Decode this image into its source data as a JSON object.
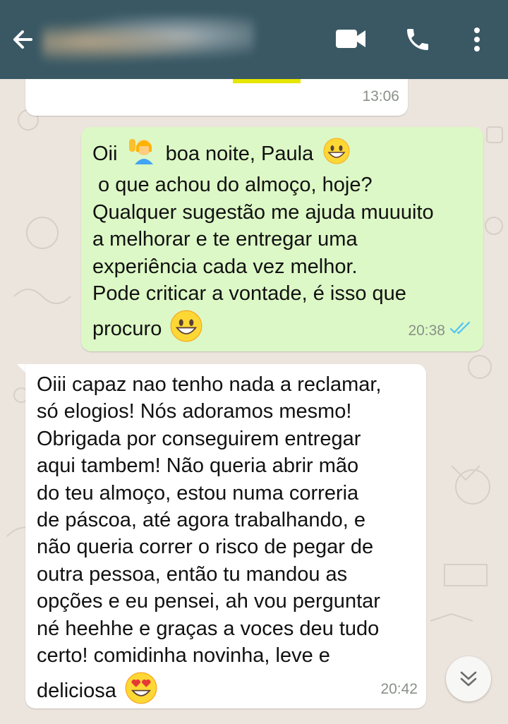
{
  "header": {
    "back_icon": "arrow-left-icon",
    "contact_name_blurred": true,
    "video_call_icon": "videocam-icon",
    "voice_call_icon": "phone-icon",
    "menu_icon": "more-vert-icon",
    "color": "#395864"
  },
  "messages": [
    {
      "direction": "in",
      "lines": [],
      "time": "13:06"
    },
    {
      "direction": "out",
      "lines": [
        "Oii",
        "boa noite, Paula",
        " o que achou do almoço, hoje?",
        "Qualquer sugestão me ajuda muuuito",
        "a melhorar e te entregar uma",
        "experiência cada vez melhor.",
        "Pode criticar a vontade, é isso que",
        "procuro"
      ],
      "time": "20:38",
      "status": "read-double-check"
    },
    {
      "direction": "in",
      "lines": [
        "Oiii capaz nao tenho nada a reclamar,",
        "só elogios! Nós adoramos mesmo!",
        "Obrigada por conseguirem entregar",
        "aqui tambem! Não queria abrir mão",
        "do teu almoço, estou numa correria",
        "de páscoa, até agora trabalhando, e",
        "não queria correr o risco de pegar de",
        "outra pessoa, então tu mandou as",
        "opções e eu pensei, ah vou perguntar",
        "né heehhe e graças a voces deu tudo",
        "certo! comidinha novinha, leve e",
        "deliciosa"
      ],
      "time": "20:42"
    }
  ],
  "colors": {
    "outgoing_bubble": "#dcf8c6",
    "incoming_bubble": "#ffffff",
    "read_ticks": "#4fc3f7",
    "background": "#ece5dd"
  },
  "scroll_button_icon": "double-chevron-down-icon"
}
